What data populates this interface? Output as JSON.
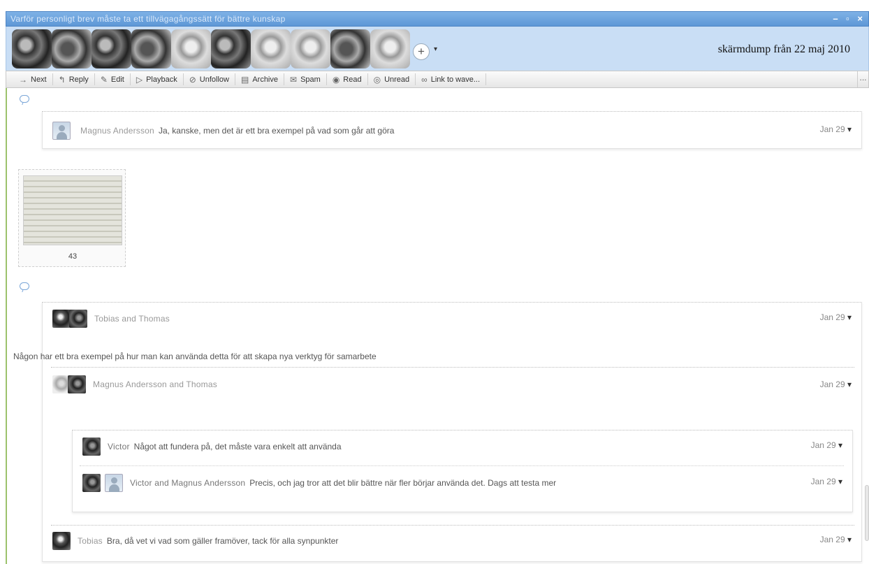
{
  "window": {
    "title": "Varför personligt brev måste ta ett tillvägagångssätt för bättre kunskap",
    "controls": [
      "–",
      "▫",
      "×"
    ]
  },
  "header": {
    "add_label": "+",
    "add_dropdown": "▾",
    "caption": "skärmdump från 22 maj 2010"
  },
  "toolbar": {
    "items": [
      {
        "icon": "→",
        "label": "Next"
      },
      {
        "icon": "↰",
        "label": "Reply"
      },
      {
        "icon": "✎",
        "label": "Edit"
      },
      {
        "icon": "▷",
        "label": "Playback"
      },
      {
        "icon": "⊘",
        "label": "Unfollow"
      },
      {
        "icon": "▤",
        "label": "Archive"
      },
      {
        "icon": "✉",
        "label": "Spam"
      },
      {
        "icon": "◉",
        "label": "Read"
      },
      {
        "icon": "◎",
        "label": "Unread"
      },
      {
        "icon": "∞",
        "label": "Link to wave..."
      }
    ],
    "more": "..."
  },
  "blips": [
    {
      "author": "Magnus Andersson",
      "text": "Ja, kanske, men det är ett bra exempel på vad som går att göra",
      "date": "Jan 29"
    },
    {
      "author": "Tobias and Thomas",
      "text": "",
      "date": "Jan 29"
    },
    {
      "author": "Tobias and Thomas",
      "text": "Någon har ett bra exempel på hur man kan använda detta för att skapa nya verktyg för samarbete",
      "date": "Jan 29"
    },
    {
      "author": "Magnus Andersson and Thomas",
      "text": "",
      "date": "Jan 29"
    },
    {
      "author": "Victor",
      "text": "Något att fundera på, det måste vara enkelt att använda",
      "date": "Jan 29"
    },
    {
      "author": "Victor and Magnus Andersson",
      "text": "Precis, och jag tror att det blir bättre när fler börjar använda det. Dags att testa mer",
      "date": "Jan 29"
    },
    {
      "author": "Tobias",
      "text": "Bra, då vet vi vad som gäller framöver, tack för alla synpunkter",
      "date": "Jan 29"
    }
  ],
  "attachment": {
    "caption": "43"
  }
}
